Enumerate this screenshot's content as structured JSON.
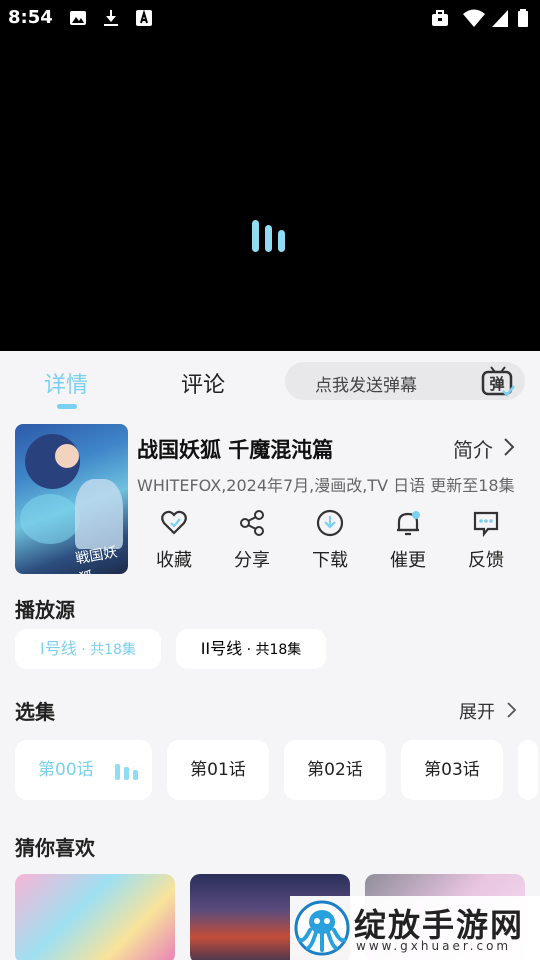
{
  "status_bar": {
    "time": "8:54",
    "left_icons": [
      "image-icon",
      "download-icon",
      "a-box-icon"
    ],
    "right_icons": [
      "briefcase-icon",
      "wifi-icon",
      "signal-icon",
      "battery-icon"
    ]
  },
  "tabs": [
    {
      "label": "详情",
      "active": true
    },
    {
      "label": "评论",
      "active": false
    }
  ],
  "danmu": {
    "placeholder": "点我发送弹幕",
    "icon_label": "弹"
  },
  "show": {
    "cover_text": "戦国妖狐",
    "title": "战国妖狐 千魔混沌篇",
    "intro_label": "简介",
    "meta": "WHITEFOX,2024年7月,漫画改,TV 日语 更新至18集"
  },
  "actions": [
    {
      "label": "收藏",
      "icon": "heart-icon"
    },
    {
      "label": "分享",
      "icon": "share-icon"
    },
    {
      "label": "下载",
      "icon": "download-icon"
    },
    {
      "label": "催更",
      "icon": "bell-icon"
    },
    {
      "label": "反馈",
      "icon": "feedback-icon"
    }
  ],
  "sources": {
    "title": "播放源",
    "items": [
      {
        "name": "I号线",
        "count": " · 共18集",
        "active": true
      },
      {
        "name": "II号线",
        "count": " · 共18集",
        "active": false
      }
    ]
  },
  "episodes": {
    "title": "选集",
    "expand_label": "展开",
    "items": [
      {
        "label": "第00话",
        "active": true
      },
      {
        "label": "第01话",
        "active": false
      },
      {
        "label": "第02话",
        "active": false
      },
      {
        "label": "第03话",
        "active": false
      }
    ]
  },
  "recommend": {
    "title": "猜你喜欢"
  },
  "watermark": {
    "title": "绽放手游网",
    "url": "www.gxhuaer.com"
  },
  "colors": {
    "accent": "#7ad0ee",
    "background": "#f5f5f7",
    "player": "#000000"
  }
}
